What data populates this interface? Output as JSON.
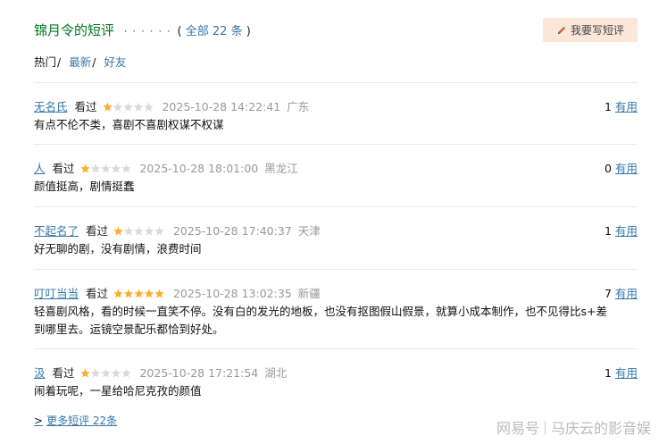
{
  "section": {
    "title": "锦月令的短评",
    "dots": "· · · · · ·",
    "total_open": "(",
    "total_link": "全部 22 条",
    "total_close": ")"
  },
  "write_button": {
    "label": "我要写短评",
    "icon": "pencil-icon",
    "bg_color": "#fbe7d8"
  },
  "filters": [
    {
      "label": "热门",
      "selected": true
    },
    {
      "label": "最新",
      "selected": false
    },
    {
      "label": "好友",
      "selected": false
    }
  ],
  "filter_sep": "/",
  "comments": [
    {
      "user": "无名氏",
      "watched": "看过",
      "rating": 1,
      "time": "2025-10-28 14:22:41",
      "location": "广东",
      "useful_count": "1",
      "useful_label": "有用",
      "text": "有点不伦不类，喜剧不喜剧权谋不权谋"
    },
    {
      "user": "人",
      "watched": "看过",
      "rating": 1,
      "time": "2025-10-28 18:01:00",
      "location": "黑龙江",
      "useful_count": "0",
      "useful_label": "有用",
      "text": "颜值挺高，剧情挺蠢"
    },
    {
      "user": "不起名了",
      "watched": "看过",
      "rating": 1,
      "time": "2025-10-28 17:40:37",
      "location": "天津",
      "useful_count": "1",
      "useful_label": "有用",
      "text": "好无聊的剧，没有剧情，浪费时间"
    },
    {
      "user": "叮叮当当",
      "watched": "看过",
      "rating": 5,
      "time": "2025-10-28 13:02:35",
      "location": "新疆",
      "useful_count": "7",
      "useful_label": "有用",
      "text_lines": [
        "轻喜剧风格，看的时候一直笑不停。没有白的发光的地板，也没有抠图假山假景，就算小成本制作，也不见得比s+差",
        "到哪里去。运镜空景配乐都恰到好处。"
      ]
    },
    {
      "user": "汲",
      "watched": "看过",
      "rating": 1,
      "time": "2025-10-28 17:21:54",
      "location": "湖北",
      "useful_count": "1",
      "useful_label": "有用",
      "text": "闹着玩呢，一星给哈尼克孜的颜值"
    }
  ],
  "more_link": {
    "arrow": ">",
    "label": "更多短评 22条"
  },
  "watermark": {
    "brand": "网易号",
    "account": "马庆云的影音娱"
  },
  "colors": {
    "link": "#3377aa",
    "section_title": "#007722",
    "star_on": "#ffac2d",
    "star_off": "#d9d9d9"
  }
}
